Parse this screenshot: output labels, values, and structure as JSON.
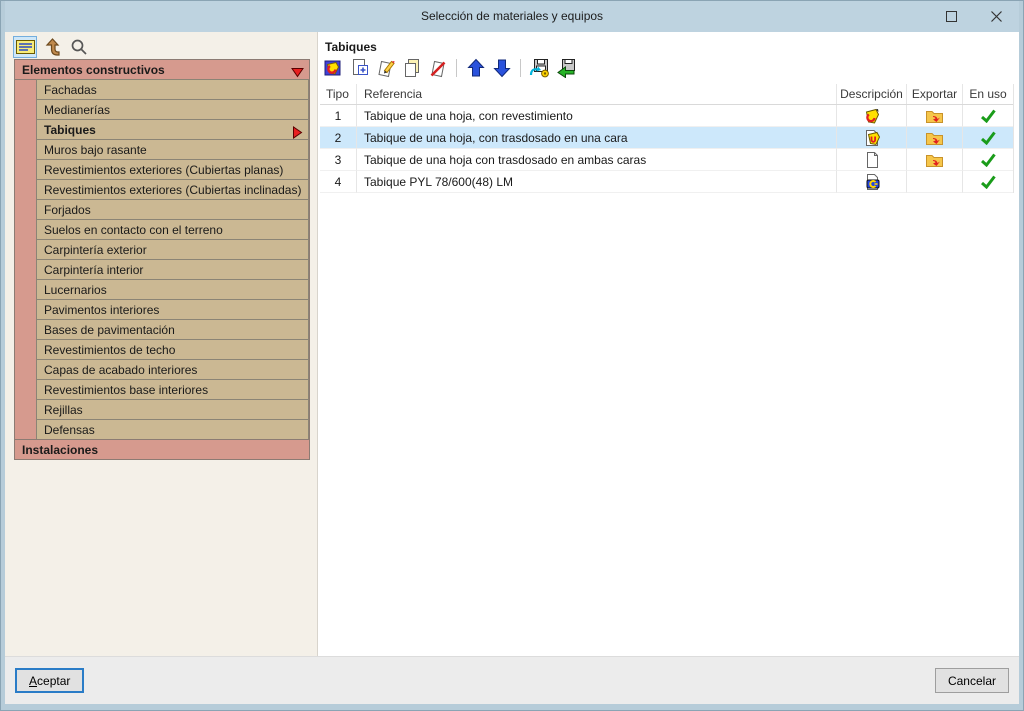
{
  "window": {
    "title": "Selección de materiales y equipos",
    "buttons": [
      {
        "name": "maximize"
      },
      {
        "name": "close"
      }
    ]
  },
  "sidebar": {
    "toolbar": [
      {
        "name": "list-view",
        "selected": true
      },
      {
        "name": "up-level",
        "selected": false
      },
      {
        "name": "search",
        "selected": false
      }
    ],
    "groups": [
      {
        "label": "Elementos constructivos",
        "expanded": true,
        "selected_item": "Tabiques",
        "items": [
          "Fachadas",
          "Medianerías",
          "Tabiques",
          "Muros bajo rasante",
          "Revestimientos exteriores (Cubiertas planas)",
          "Revestimientos exteriores (Cubiertas inclinadas)",
          "Forjados",
          "Suelos en contacto con el terreno",
          "Carpintería exterior",
          "Carpintería interior",
          "Lucernarios",
          "Pavimentos interiores",
          "Bases de pavimentación",
          "Revestimientos de techo",
          "Capas de acabado interiores",
          "Revestimientos base interiores",
          "Rejillas",
          "Defensas"
        ]
      },
      {
        "label": "Instalaciones",
        "expanded": false,
        "selected_item": null,
        "items": []
      }
    ]
  },
  "main": {
    "panel_title": "Tabiques",
    "toolbar": [
      {
        "name": "element-types"
      },
      {
        "name": "add"
      },
      {
        "name": "edit"
      },
      {
        "name": "copy"
      },
      {
        "name": "delete"
      },
      {
        "name": "separator"
      },
      {
        "name": "move-up"
      },
      {
        "name": "move-down"
      },
      {
        "name": "separator"
      },
      {
        "name": "import-library"
      },
      {
        "name": "export-library"
      }
    ],
    "table": {
      "columns": [
        "Tipo",
        "Referencia",
        "Descripción",
        "Exportar",
        "En uso"
      ],
      "rows": [
        {
          "tipo": "1",
          "referencia": "Tabique de una hoja, con revestimiento",
          "desc_icon": "element-tag",
          "exportar": true,
          "en_uso": true,
          "selected": false
        },
        {
          "tipo": "2",
          "referencia": "Tabique de una hoja, con trasdosado en una cara",
          "desc_icon": "doc-element",
          "exportar": true,
          "en_uso": true,
          "selected": true
        },
        {
          "tipo": "3",
          "referencia": "Tabique de una hoja con trasdosado en ambas caras",
          "desc_icon": "doc",
          "exportar": true,
          "en_uso": true,
          "selected": false
        },
        {
          "tipo": "4",
          "referencia": "Tabique PYL 78/600(48) LM",
          "desc_icon": "doc-bim",
          "exportar": false,
          "en_uso": true,
          "selected": false
        }
      ]
    }
  },
  "footer": {
    "accept_key": "A",
    "accept_rest": "ceptar",
    "cancel_label": "Cancelar"
  },
  "colors": {
    "titlebar": "#bed3e0",
    "window_border": "#b6ccd9",
    "sidebar_bg": "#f4f0e8",
    "group_header_bg": "#d69a8e",
    "tree_item_bg": "#cbb893",
    "selected_row_bg": "#cde8fb",
    "check_green": "#1a9c1a",
    "folder_yellow": "#f6c64a",
    "accent_blue": "#2a7cc7"
  }
}
